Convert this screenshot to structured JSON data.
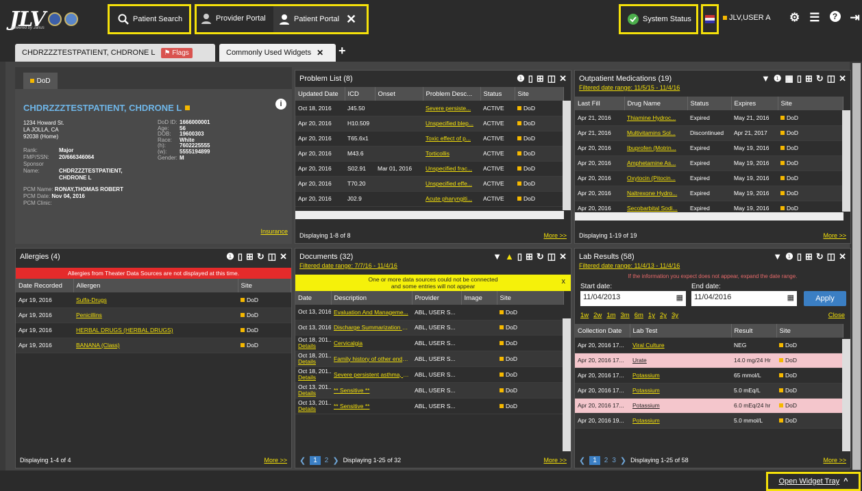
{
  "app": {
    "logo": "JLV",
    "powered": "powered by Janus"
  },
  "topbar": {
    "patient_search": "Patient Search",
    "provider_portal": "Provider Portal",
    "patient_portal": "Patient Portal",
    "system_status": "System Status",
    "user": "JLV,USER A"
  },
  "tabs": {
    "patient": "CHDRZZZTESTPATIENT, CHDRONE L",
    "flags": "Flags",
    "widgets": "Commonly Used Widgets"
  },
  "demographics": {
    "tab": "DoD",
    "name": "CHDRZZZTESTPATIENT, CHDRONE L",
    "address1": "1234 Howard St.",
    "address2": "LA JOLLA, CA",
    "address3": "92038 (Home)",
    "rank_l": "Rank:",
    "rank": "Major",
    "fmp_l": "FMP/SSN:",
    "fmp": "20/666346064",
    "sponsor_l": "Sponsor Name:",
    "sponsor": "CHDRZZZTESTPATIENT,",
    "sponsor2": "CHDRONE L",
    "dodid_l": "DoD ID:",
    "dodid": "1666000001",
    "age_l": "Age:",
    "age": "56",
    "dob_l": "DOB:",
    "dob": "19600303",
    "race_l": "Race:",
    "race": "White",
    "h_l": "(h):",
    "h": "7602225555",
    "w_l": "(w):",
    "w": "5555194899",
    "gender_l": "Gender:",
    "gender": "M",
    "pcm_name_l": "PCM Name:",
    "pcm_name": "RONAY,THOMAS ROBERT",
    "pcm_date_l": "PCM Date:",
    "pcm_date": "Nov 04, 2016",
    "pcm_clinic_l": "PCM Clinic:",
    "insurance": "Insurance"
  },
  "problems": {
    "title": "Problem List (8)",
    "cols": [
      "Updated Date",
      "ICD",
      "Onset",
      "Problem Desc...",
      "Status",
      "Site"
    ],
    "rows": [
      [
        "Oct 18, 2016",
        "J45.50",
        "",
        "Severe persiste...",
        "ACTIVE",
        "DoD"
      ],
      [
        "Apr 20, 2016",
        "H10.509",
        "",
        "Unspecified blep...",
        "ACTIVE",
        "DoD"
      ],
      [
        "Apr 20, 2016",
        "T65.6x1",
        "",
        "Toxic effect of p...",
        "ACTIVE",
        "DoD"
      ],
      [
        "Apr 20, 2016",
        "M43.6",
        "",
        "Torticollis",
        "ACTIVE",
        "DoD"
      ],
      [
        "Apr 20, 2016",
        "S02.91",
        "Mar 01, 2016",
        "Unspecified frac...",
        "ACTIVE",
        "DoD"
      ],
      [
        "Apr 20, 2016",
        "T70.20",
        "",
        "Unspecified effe...",
        "ACTIVE",
        "DoD"
      ],
      [
        "Apr 20, 2016",
        "J02.9",
        "",
        "Acute pharyngiti...",
        "ACTIVE",
        "DoD"
      ]
    ],
    "footer": "Displaying 1-8 of 8",
    "more": "More >>"
  },
  "meds": {
    "title": "Outpatient Medications (19)",
    "filter": "Filtered date range: 11/5/15 - 11/4/16",
    "cols": [
      "Last Fill",
      "Drug Name",
      "Status",
      "Expires",
      "Site"
    ],
    "rows": [
      [
        "Apr 21, 2016",
        "Thiamine Hydroc...",
        "Expired",
        "May 21, 2016",
        "DoD"
      ],
      [
        "Apr 21, 2016",
        "Multivitamins Sol...",
        "Discontinued",
        "Apr 21, 2017",
        "DoD"
      ],
      [
        "Apr 20, 2016",
        "Ibuprofen (Motrin...",
        "Expired",
        "May 19, 2016",
        "DoD"
      ],
      [
        "Apr 20, 2016",
        "Amphetamine As...",
        "Expired",
        "May 19, 2016",
        "DoD"
      ],
      [
        "Apr 20, 2016",
        "Oxytocin (Pitocin...",
        "Expired",
        "May 19, 2016",
        "DoD"
      ],
      [
        "Apr 20, 2016",
        "Naltrexone Hydro...",
        "Expired",
        "May 19, 2016",
        "DoD"
      ],
      [
        "Apr 20, 2016",
        "Secobarbital Sodi...",
        "Expired",
        "May 19, 2016",
        "DoD"
      ]
    ],
    "footer": "Displaying 1-19 of 19",
    "more": "More >>"
  },
  "allergies": {
    "title": "Allergies (4)",
    "warning": "Allergies from Theater Data Sources are not displayed at this time.",
    "cols": [
      "Date Recorded",
      "Allergen",
      "Site"
    ],
    "rows": [
      [
        "Apr 19, 2016",
        "Sulfa-Drugs",
        "DoD"
      ],
      [
        "Apr 19, 2016",
        "Penicillins",
        "DoD"
      ],
      [
        "Apr 19, 2016",
        "HERBAL DRUGS (HERBAL DRUGS)",
        "DoD"
      ],
      [
        "Apr 19, 2016",
        "BANANA (Class)",
        "DoD"
      ]
    ],
    "footer": "Displaying 1-4 of 4",
    "more": "More >>"
  },
  "documents": {
    "title": "Documents (32)",
    "filter": "Filtered date range: 7/7/16 - 11/4/16",
    "warning1": "One or more data sources could not be connected",
    "warning2": "and some entries will not appear",
    "close": "x",
    "cols": [
      "Date",
      "Description",
      "Provider",
      "Image",
      "Site"
    ],
    "rows": [
      [
        "Oct 13, 2016",
        "",
        "Evaluation And Manageme...",
        "ABL, USER S...",
        "",
        "DoD"
      ],
      [
        "Oct 13, 2016",
        "",
        "Discharge Summarization N...",
        "ABL, USER S...",
        "",
        "DoD"
      ],
      [
        "Oct 18, 201...",
        "Details",
        "Cervicalgia",
        "ABL, USER S...",
        "",
        "DoD"
      ],
      [
        "Oct 18, 201...",
        "Details",
        "Family history of other endo...",
        "ABL, USER S...",
        "",
        "DoD"
      ],
      [
        "Oct 18, 201...",
        "Details",
        "Severe persistent asthma, u...",
        "ABL, USER S...",
        "",
        "DoD"
      ],
      [
        "Oct 13, 201...",
        "Details",
        "** Sensitive **",
        "ABL, USER S...",
        "",
        "DoD"
      ],
      [
        "Oct 13, 201...",
        "Details",
        "** Sensitive **",
        "ABL, USER S...",
        "",
        "DoD"
      ]
    ],
    "pages": [
      "1",
      "2"
    ],
    "footer": "Displaying 1-25 of 32",
    "more": "More >>"
  },
  "labs": {
    "title": "Lab Results (58)",
    "filter": "Filtered date range: 11/4/13 - 11/4/16",
    "hint": "If the information you expect does not appear, expand the date range.",
    "start_label": "Start date:",
    "start": "11/04/2013",
    "end_label": "End date:",
    "end": "11/04/2016",
    "apply": "Apply",
    "ranges": [
      "1w",
      "2w",
      "1m",
      "3m",
      "6m",
      "1y",
      "2y",
      "3y"
    ],
    "close": "Close",
    "cols": [
      "Collection Date",
      "Lab Test",
      "Result",
      "Site"
    ],
    "rows": [
      [
        "Apr 20, 2016 17...",
        "Viral Culture",
        "NEG",
        "DoD"
      ],
      [
        "Apr 20, 2016 17...",
        "Urate",
        "14.0 mg/24 Hr",
        "DoD"
      ],
      [
        "Apr 20, 2016 17...",
        "Potassium",
        "65 mmol/L",
        "DoD"
      ],
      [
        "Apr 20, 2016 17...",
        "Potassium",
        "5.0 mEq/L",
        "DoD"
      ],
      [
        "Apr 20, 2016 17...",
        "Potassium",
        "6.0 mEq/24 hr",
        "DoD"
      ],
      [
        "Apr 20, 2016 19...",
        "Potassium",
        "5.0 mmol/L",
        "DoD"
      ]
    ],
    "pink_rows": [
      1,
      4
    ],
    "pages": [
      "1",
      "2",
      "3"
    ],
    "footer": "Displaying 1-25 of 58",
    "more": "More >>"
  },
  "bottom": {
    "tray": "Open Widget Tray"
  }
}
